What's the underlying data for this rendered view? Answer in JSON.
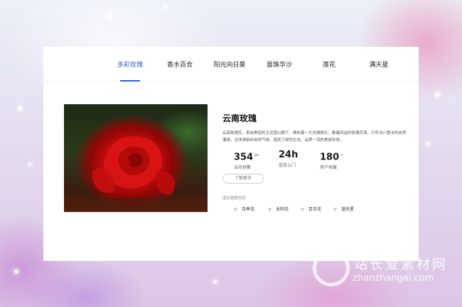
{
  "tabs": [
    {
      "label": "多彩玫瑰",
      "active": true
    },
    {
      "label": "香水百合",
      "active": false
    },
    {
      "label": "阳光向日葵",
      "active": false
    },
    {
      "label": "昙珠华沙",
      "active": false
    },
    {
      "label": "莲花",
      "active": false
    },
    {
      "label": "满天星",
      "active": false
    }
  ],
  "product": {
    "title": "云南玫瑰",
    "description": "云南玫瑰花，来自美丽的玉龙雪山脚下，静卧着一片优雅栀红、散着四溢的玫瑰花海，万年冰川雪水的自然灌溉，洁净清新的自然气候，造就了绿色生态、品质一流的美丽传奇。",
    "stats": [
      {
        "value": "354",
        "unit": "pr",
        "label": "当月销售"
      },
      {
        "value": "24h",
        "unit": "",
        "label": "送货上门"
      },
      {
        "value": "180",
        "unit": "+",
        "label": "用户收藏"
      }
    ],
    "more_label": "了解更多"
  },
  "related": {
    "label": "适合搭配的花",
    "items": [
      "月季花",
      "太阳花",
      "百合花",
      "漫天星"
    ]
  },
  "watermark": {
    "cn": "站长爱素材网",
    "en": "zhanzhangai.com"
  },
  "colors": {
    "accent": "#2b5fd9"
  }
}
